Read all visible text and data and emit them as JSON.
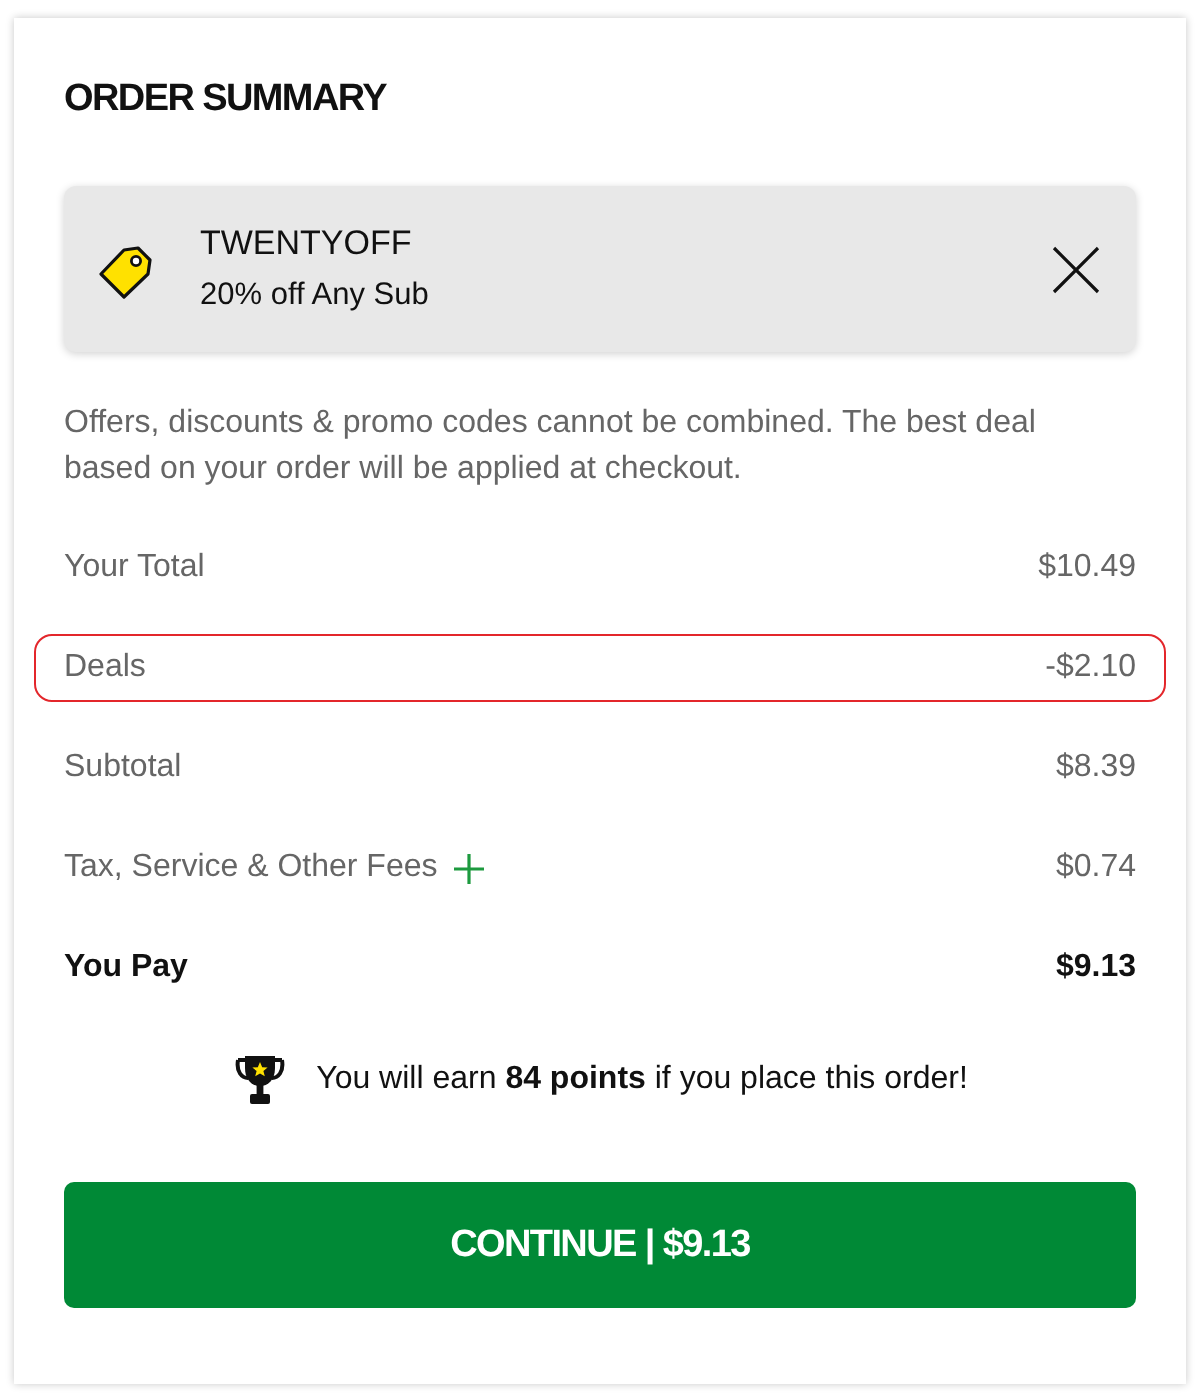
{
  "title": "ORDER SUMMARY",
  "promo": {
    "code": "TWENTYOFF",
    "description": "20% off Any Sub"
  },
  "notice": "Offers, discounts & promo codes cannot be combined. The best deal based on your order will be applied at checkout.",
  "lines": [
    {
      "label": "Your Total",
      "amount": "$10.49",
      "kind": "plain",
      "highlighted": false
    },
    {
      "label": "Deals",
      "amount": "-$2.10",
      "kind": "plain",
      "highlighted": true
    },
    {
      "label": "Subtotal",
      "amount": "$8.39",
      "kind": "plain",
      "highlighted": false
    },
    {
      "label": "Tax, Service & Other Fees",
      "amount": "$0.74",
      "kind": "expandable",
      "highlighted": false
    },
    {
      "label": "You Pay",
      "amount": "$9.13",
      "kind": "total",
      "highlighted": false
    }
  ],
  "rewards": {
    "message": "You will earn **84 points** if you place this order!"
  },
  "continue_button": {
    "label": "CONTINUE | $9.13"
  }
}
